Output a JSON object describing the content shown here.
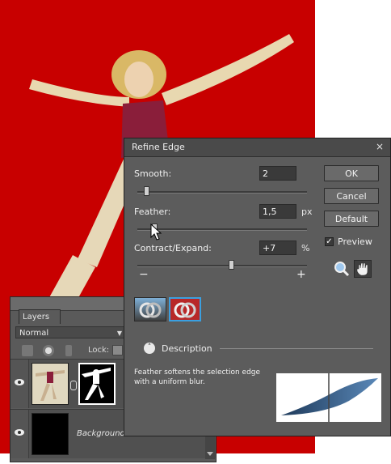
{
  "dialog": {
    "title": "Refine Edge",
    "close_glyph": "×",
    "fields": [
      {
        "label": "Smooth:",
        "value": "2",
        "unit": ""
      },
      {
        "label": "Feather:",
        "value": "1,5",
        "unit": "px"
      },
      {
        "label": "Contract/Expand:",
        "value": "+7",
        "unit": "%"
      }
    ],
    "slider_levels": {
      "smooth": 0.05,
      "feather": 0.1,
      "contract_expand": 0.55
    },
    "slider_min": "−",
    "slider_max": "+",
    "buttons": {
      "ok": "OK",
      "cancel": "Cancel",
      "default": "Default"
    },
    "preview": {
      "label": "Preview",
      "checked": true,
      "check_glyph": "✓"
    },
    "view_tools": [
      "zoom-icon",
      "hand-icon"
    ],
    "view_modes": [
      "custom-overlay-view",
      "standard-view"
    ],
    "description": {
      "toggle_glyph": "˄",
      "heading": "Description",
      "text": "Feather softens the selection edge with a uniform blur."
    }
  },
  "layers_panel": {
    "tab": "Layers",
    "blend_mode": "Normal",
    "lock_label": "Lock:",
    "layers": [
      {
        "name": "",
        "visible": true,
        "has_mask": true
      },
      {
        "name": "Background",
        "visible": true,
        "has_mask": false
      }
    ]
  },
  "colors": {
    "canvas_background": "#c80000",
    "dialog_bg": "#5c5c5c",
    "selected_view_border": "#3aa0e0"
  }
}
